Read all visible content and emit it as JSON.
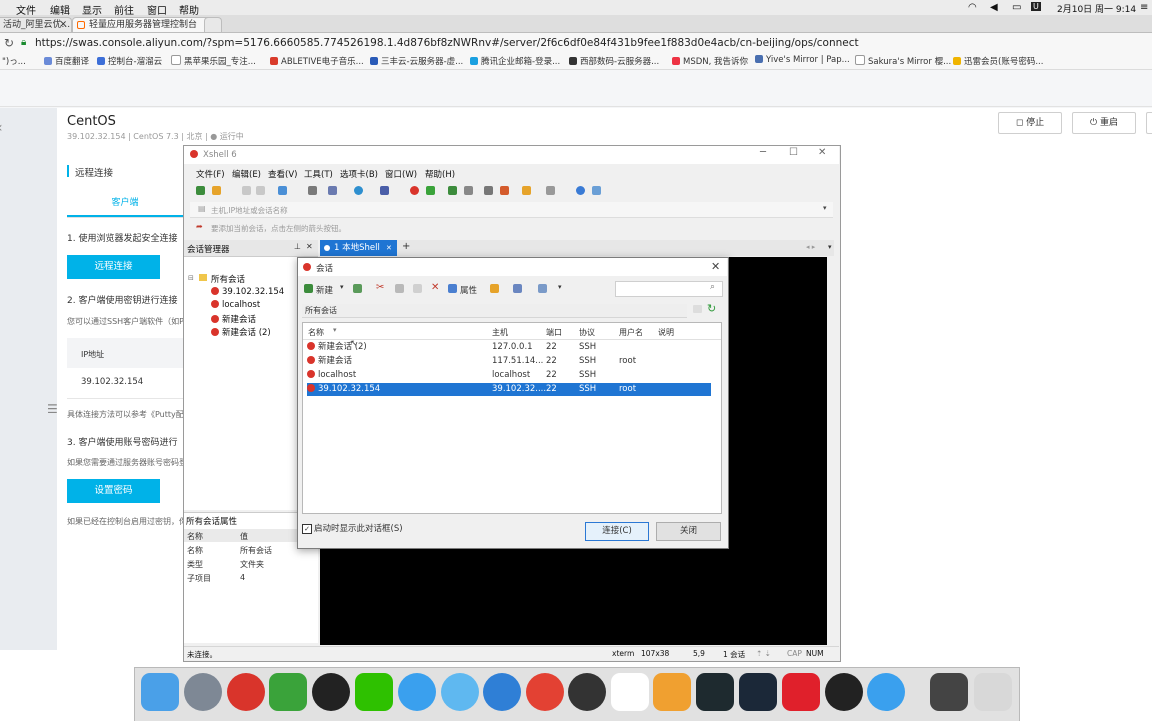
{
  "menubar": {
    "items": [
      "文件",
      "编辑",
      "显示",
      "前往",
      "窗口",
      "帮助"
    ],
    "clock": "2月10日 周一 9:14"
  },
  "tabs": [
    {
      "label": "活动_阿里云优...",
      "active": false
    },
    {
      "label": "轻量应用服务器管理控制台",
      "active": true
    }
  ],
  "address": {
    "url": "https://swas.console.aliyun.com/?spm=5176.6660585.774526198.1.4d876bf8zNWRnv#/server/2f6c6df0e84f431b9fee1f883d0e4acb/cn-beijing/ops/connect"
  },
  "bookmarks": [
    "\")っ...",
    "百度翻译",
    "控制台-溜溜云",
    "黑苹果乐园_专注...",
    "ABLETIVE电子音乐...",
    "三丰云-云服务器-虚...",
    "腾讯企业邮箱-登录...",
    "西部数码-云服务器...",
    "MSDN, 我告诉你",
    "Yive's Mirror | Pap...",
    "Sakura's Mirror 樱...",
    "迅雷会员(账号密码..."
  ],
  "server": {
    "name": "CentOS",
    "meta": "39.102.32.154 | CentOS 7.3 | 北京 | ● 运行中",
    "stop_label": "停止",
    "restart_label": "重启"
  },
  "remote": {
    "section_title": "远程连接",
    "client_tab": "客户端",
    "step1": "1. 使用浏览器发起安全连接",
    "connect_button": "远程连接",
    "step2": "2. 客户端使用密钥进行连接",
    "hint2": "您可以通过SSH客户端软件（如P",
    "ip_header": "IP地址",
    "ip_value": "39.102.32.154",
    "ref_text": "具体连接方法可以参考《Putty配",
    "step3": "3. 客户端使用账号密码进行",
    "hint3": "如果您需要通过服务器账号密码登",
    "set_password_button": "设置密码",
    "hint4": "如果已经在控制台启用过密钥，你"
  },
  "xshell": {
    "title": "Xshell 6",
    "menu": [
      "文件(F)",
      "编辑(E)",
      "查看(V)",
      "工具(T)",
      "选项卡(B)",
      "窗口(W)",
      "帮助(H)"
    ],
    "address_placeholder": "主机,IP地址或会话名称",
    "hint": "要添加当前会话，点击左侧的箭头按钮。",
    "session_manager_title": "会话管理器",
    "session_tree_root": "所有会话",
    "session_tree": [
      "39.102.32.154",
      "localhost",
      "新建会话",
      "新建会话 (2)"
    ],
    "tab_label": "1 本地Shell",
    "props_title": "所有会话属性",
    "props_headers": [
      "名称",
      "值"
    ],
    "props_rows": [
      [
        "名称",
        "所有会话"
      ],
      [
        "类型",
        "文件夹"
      ],
      [
        "子项目",
        "4"
      ]
    ],
    "status_left": "未连接。",
    "status_items": [
      "xterm",
      "107x38",
      "5,9",
      "1 会话",
      "CAP",
      "NUM"
    ]
  },
  "dialog": {
    "title": "会话",
    "new_label": "新建",
    "props_label": "属性",
    "path": "所有会话",
    "columns": [
      "名称",
      "主机",
      "端口",
      "协议",
      "用户名",
      "说明"
    ],
    "rows": [
      [
        "新建会话 (2)",
        "127.0.0.1",
        "22",
        "SSH",
        "",
        ""
      ],
      [
        "新建会话",
        "117.51.14...",
        "22",
        "SSH",
        "root",
        ""
      ],
      [
        "localhost",
        "localhost",
        "22",
        "SSH",
        "",
        ""
      ],
      [
        "39.102.32.154",
        "39.102.32....",
        "22",
        "SSH",
        "root",
        ""
      ]
    ],
    "selected_row": 3,
    "startup_checkbox": "启动时显示此对话框(S)",
    "connect_button": "连接(C)",
    "close_button": "关闭"
  },
  "colors": {
    "accent": "#00b2e8",
    "selection": "#1f75d3",
    "xshell_tab": "#1f75d3",
    "terminal": "#000000"
  }
}
